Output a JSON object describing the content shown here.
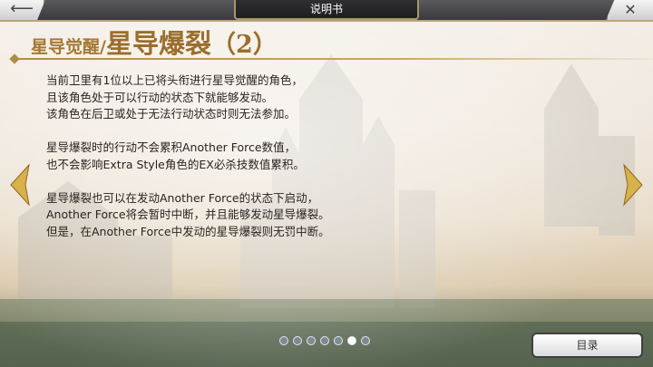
{
  "window": {
    "title": "说明书"
  },
  "nav": {
    "back_icon": "back-arrow-icon",
    "close_icon": "close-icon",
    "back_glyph": "⟵",
    "close_glyph": "✕"
  },
  "heading": {
    "subtitle": "星导觉醒/",
    "title": "星导爆裂",
    "number": "（2）"
  },
  "paragraphs": [
    {
      "lines": [
        "当前卫里有1位以上已将头衔进行星导觉醒的角色，",
        "且该角色处于可以行动的状态下就能够发动。",
        "该角色在后卫或处于无法行动状态时则无法参加。"
      ]
    },
    {
      "lines": [
        "星导爆裂时的行动不会累积Another Force数值，",
        "也不会影响Extra Style角色的EX必杀技数值累积。"
      ]
    },
    {
      "lines": [
        "星导爆裂也可以在发动Another Force的状态下启动，",
        "Another Force将会暂时中断，并且能够发动星导爆裂。",
        "但是，在Another Force中发动的星导爆裂则无罚中断。"
      ]
    }
  ],
  "pagination": {
    "total": 7,
    "current": 6
  },
  "buttons": {
    "toc_label": "目录"
  },
  "colors": {
    "heading_gold": "#9a6e2c",
    "text": "#2a2422",
    "arrow_gold": "#d9b14a",
    "dot_inactive": "#7f8897"
  }
}
